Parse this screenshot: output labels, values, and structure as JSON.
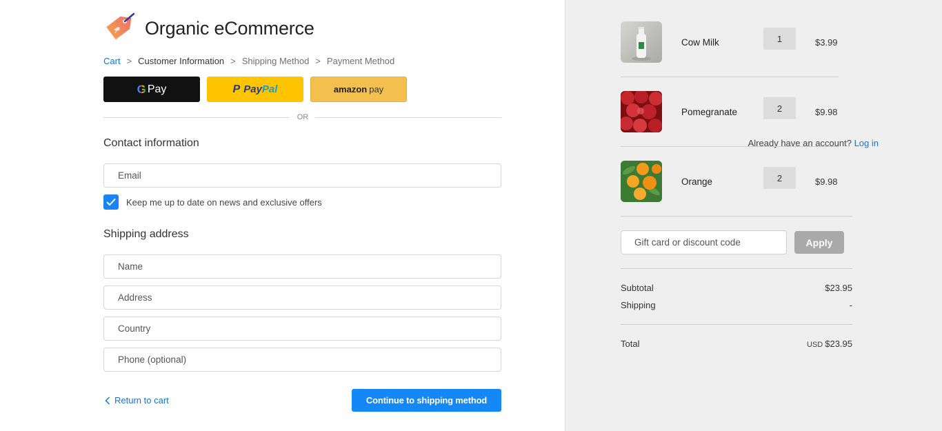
{
  "brand": {
    "name": "Organic eCommerce"
  },
  "breadcrumb": {
    "items": [
      "Cart",
      "Customer Information",
      "Shipping Method",
      "Payment Method"
    ],
    "separator": ">"
  },
  "express_pay": {
    "google": {
      "g": "G",
      "text": "Pay"
    },
    "paypal": {
      "mark": "P",
      "word1": "Pay",
      "word2": "Pal"
    },
    "amazon": {
      "word1": "amazon",
      "word2": "pay"
    },
    "divider_text": "OR"
  },
  "contact": {
    "heading": "Contact information",
    "account_prompt": "Already have an account?",
    "login_link": "Log in",
    "email_placeholder": "Email",
    "newsletter_label": "Keep me up to date on news and exclusive offers",
    "newsletter_checked": true
  },
  "shipping": {
    "heading": "Shipping address",
    "name_placeholder": "Name",
    "address_placeholder": "Address",
    "country_placeholder": "Country",
    "phone_placeholder": "Phone (optional)"
  },
  "actions": {
    "return_label": "Return to cart",
    "continue_label": "Continue to shipping method"
  },
  "cart": {
    "items": [
      {
        "name": "Cow Milk",
        "qty": "1",
        "price": "$3.99"
      },
      {
        "name": "Pomegranate",
        "qty": "2",
        "price": "$9.98"
      },
      {
        "name": "Orange",
        "qty": "2",
        "price": "$9.98"
      }
    ],
    "discount_placeholder": "Gift card or discount code",
    "apply_label": "Apply",
    "subtotal_label": "Subtotal",
    "subtotal_value": "$23.95",
    "shipping_label": "Shipping",
    "shipping_value": "-",
    "total_label": "Total",
    "total_currency": "USD",
    "total_value": "$23.95"
  },
  "colors": {
    "accent": "#1488f7",
    "link": "#1773d8",
    "sidebar_bg": "#efefef"
  }
}
